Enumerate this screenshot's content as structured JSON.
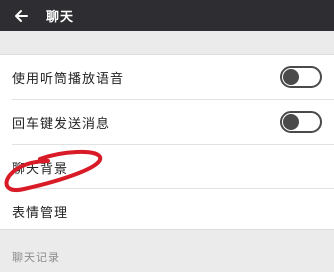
{
  "header": {
    "back_icon": "arrow-left-icon",
    "title": "聊天"
  },
  "settings": [
    {
      "label": "使用听筒播放语音",
      "toggle": "off"
    },
    {
      "label": "回车键发送消息",
      "toggle": "off"
    },
    {
      "label": "聊天背景"
    },
    {
      "label": "表情管理"
    }
  ],
  "section_header": "聊天记录",
  "colors": {
    "topbar": "#2e2e32",
    "annotation": "#d81b27"
  }
}
